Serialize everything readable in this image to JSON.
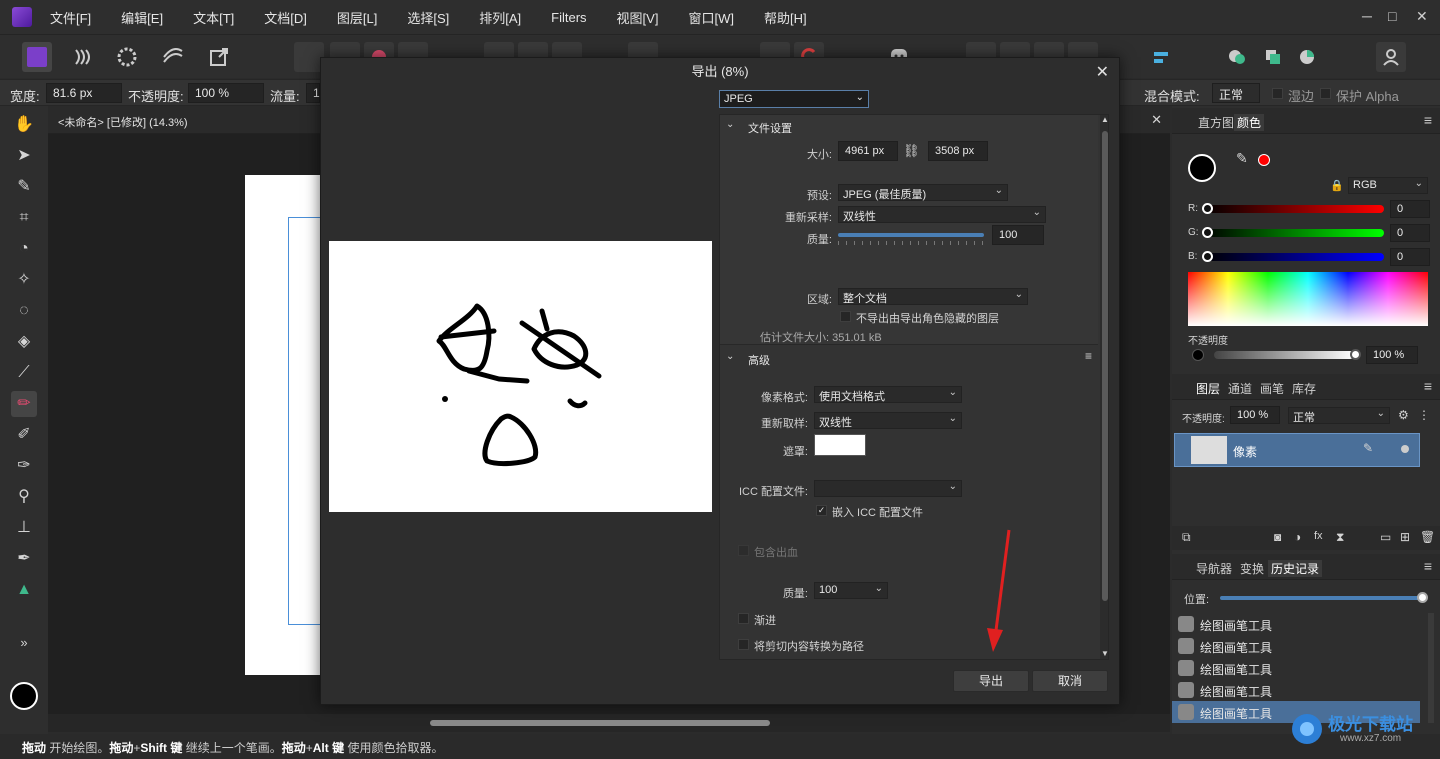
{
  "menubar": {
    "items": [
      "文件[F]",
      "编辑[E]",
      "文本[T]",
      "文档[D]",
      "图层[L]",
      "选择[S]",
      "排列[A]",
      "Filters",
      "视图[V]",
      "窗口[W]",
      "帮助[H]"
    ],
    "window_controls": [
      "─",
      "□",
      "✕"
    ]
  },
  "context_bar": {
    "width_label": "宽度:",
    "width_value": "81.6 px",
    "opacity_label": "不透明度:",
    "opacity_value": "100 %",
    "flow_label": "流量:",
    "flow_value": "1",
    "blend_label": "混合模式:",
    "blend_value": "正常",
    "wet_edges": "湿边",
    "protect_alpha": "保护 Alpha"
  },
  "document": {
    "tab_title": "<未命名> [已修改] (14.3%)"
  },
  "status_bar": {
    "parts": [
      {
        "t": "拖动",
        "b": true
      },
      {
        "t": " 开始绘图。",
        "b": false
      },
      {
        "t": "拖动",
        "b": true
      },
      {
        "t": "+",
        "b": false
      },
      {
        "t": "Shift 键",
        "b": true
      },
      {
        "t": " 继续上一个笔画。",
        "b": false
      },
      {
        "t": "拖动",
        "b": true
      },
      {
        "t": "+",
        "b": false
      },
      {
        "t": "Alt 键",
        "b": true
      },
      {
        "t": " 使用颜色拾取器。",
        "b": false
      }
    ]
  },
  "dialog": {
    "title": "导出 (8%)",
    "format": "JPEG",
    "file_settings": {
      "header": "文件设置",
      "size_label": "大小:",
      "width": "4961 px",
      "height": "3508 px",
      "preset_label": "预设:",
      "preset_value": "JPEG (最佳质量)",
      "resample_label": "重新采样:",
      "resample_value": "双线性",
      "quality_label": "质量:",
      "quality_value": "100",
      "quality_fraction": 1.0,
      "area_label": "区域:",
      "area_value": "整个文档",
      "hidden_layers_label": "不导出由导出角色隐藏的图层",
      "estimate_label": "估计文件大小: 351.01 kB"
    },
    "advanced": {
      "header": "高级",
      "pixel_format_label": "像素格式:",
      "pixel_format_value": "使用文档格式",
      "resample_label": "重新取样:",
      "resample_value": "双线性",
      "matte_label": "遮罩:",
      "icc_label": "ICC 配置文件:",
      "icc_value": "",
      "embed_icc_label": "嵌入 ICC 配置文件",
      "embed_icc_checked": true,
      "bleed_label": "包含出血",
      "quality_label": "质量:",
      "quality_value": "100",
      "progressive_label": "渐进",
      "clip_label": "将剪切内容转换为路径"
    },
    "export_button": "导出",
    "cancel_button": "取消"
  },
  "right_panel": {
    "color_tabs": [
      "直方图",
      "颜色"
    ],
    "color_model": "RGB",
    "r_label": "R:",
    "r_value": "0",
    "g_label": "G:",
    "g_value": "0",
    "b_label": "B:",
    "b_value": "0",
    "opacity_label": "不透明度",
    "opacity_value": "100 %",
    "layer_tabs": [
      "图层",
      "通道",
      "画笔",
      "库存"
    ],
    "layer_opacity_label": "不透明度:",
    "layer_opacity_value": "100 %",
    "layer_blend": "正常",
    "layer_name": "像素",
    "history_tabs": [
      "导航器",
      "变换",
      "历史记录"
    ],
    "position_label": "位置:",
    "history_items": [
      "绘图画笔工具",
      "绘图画笔工具",
      "绘图画笔工具",
      "绘图画笔工具",
      "绘图画笔工具"
    ]
  },
  "watermark": {
    "text": "极光下载站",
    "url": "www.xz7.com"
  },
  "colors": {
    "accent": "#4a7fb5",
    "annotation_arrow": "#e02020"
  }
}
